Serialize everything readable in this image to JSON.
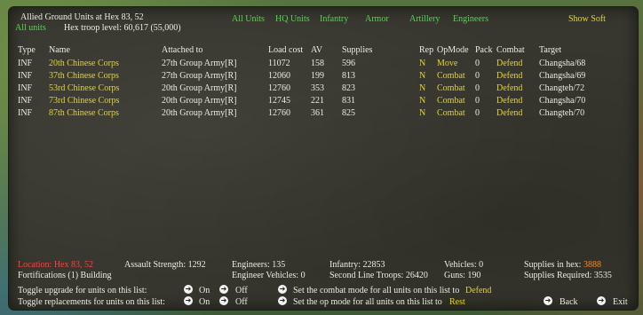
{
  "header": {
    "title": "Allied Ground Units at Hex 83, 52",
    "mode": "All units",
    "troop_level": "Hex troop level: 60,617  (55,000)",
    "filters": [
      "All Units",
      "HQ Units",
      "Infantry",
      "Armor",
      "Artillery",
      "Engineers"
    ],
    "show_soft": "Show Soft"
  },
  "table": {
    "headers": [
      "Type",
      "Name",
      "Attached to",
      "Load cost",
      "AV",
      "Supplies",
      "Rep",
      "OpMode",
      "Pack",
      "Combat",
      "Target"
    ],
    "rows": [
      [
        "INF",
        "20th Chinese Corps",
        "27th Group Army[R]",
        "11072",
        "158",
        "596",
        "N",
        "Move",
        "0",
        "Defend",
        "Changsha/68"
      ],
      [
        "INF",
        "37th Chinese Corps",
        "27th Group Army[R]",
        "12060",
        "199",
        "813",
        "N",
        "Combat",
        "0",
        "Defend",
        "Changsha/69"
      ],
      [
        "INF",
        "53rd Chinese Corps",
        "20th Group Army[R]",
        "12760",
        "353",
        "823",
        "N",
        "Combat",
        "0",
        "Defend",
        "Changteh/72"
      ],
      [
        "INF",
        "73rd Chinese Corps",
        "20th Group Army[R]",
        "12745",
        "221",
        "831",
        "N",
        "Combat",
        "0",
        "Defend",
        "Changsha/70"
      ],
      [
        "INF",
        "87th Chinese Corps",
        "20th Group Army[R]",
        "12760",
        "361",
        "825",
        "N",
        "Combat",
        "0",
        "Defend",
        "Changteh/70"
      ]
    ]
  },
  "footer": {
    "location": "Location: Hex 83, 52",
    "fortifications": "Fortifications (1) Building",
    "assault_strength": "Assault Strength: 1292",
    "engineers": "Engineers: 135",
    "engineer_vehicles": "Engineer Vehicles: 0",
    "infantry": "Infantry: 22853",
    "second_line": "Second Line Troops: 26420",
    "vehicles": "Vehicles: 0",
    "guns": "Guns: 190",
    "supplies_label": "Supplies in hex:",
    "supplies_value": "3888",
    "supplies_required": "Supplies Required: 3535"
  },
  "controls": {
    "toggle_upgrade": "Toggle upgrade for units on this list:",
    "toggle_replacements": "Toggle replacements for units on this list:",
    "on": "On",
    "off": "Off",
    "combat_mode_label": "Set the combat mode for all units on this list to",
    "combat_mode_value": "Defend",
    "op_mode_label": "Set the op mode for all units on this list to",
    "op_mode_value": "Rest",
    "back": "Back",
    "exit": "Exit"
  },
  "colors": {
    "panel": "#37372f",
    "white_text": "#ecebe4",
    "yellow_text": "#e8d51e",
    "green_text": "#3ee03a",
    "red_text": "#ff3f3f",
    "orange_text": "#ff8a1e"
  }
}
